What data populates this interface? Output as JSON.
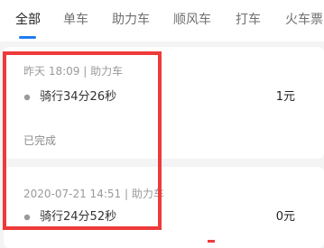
{
  "tabs": [
    {
      "label": "全部",
      "active": true
    },
    {
      "label": "单车"
    },
    {
      "label": "助力车"
    },
    {
      "label": "顺风车"
    },
    {
      "label": "打车"
    },
    {
      "label": "火车票"
    }
  ],
  "orders": [
    {
      "datetime": "昨天 18:09",
      "type": "助力车",
      "ride": "骑行34分26秒",
      "amount": "1元",
      "status": "已完成"
    },
    {
      "datetime": "2020-07-21 14:51",
      "type": "助力车",
      "ride": "骑行24分52秒",
      "amount": "0元"
    }
  ],
  "colors": {
    "accent": "#1f7cf0",
    "annotation": "#ee3a3a"
  },
  "icons": {
    "ride_marker": "location-dot-icon"
  }
}
